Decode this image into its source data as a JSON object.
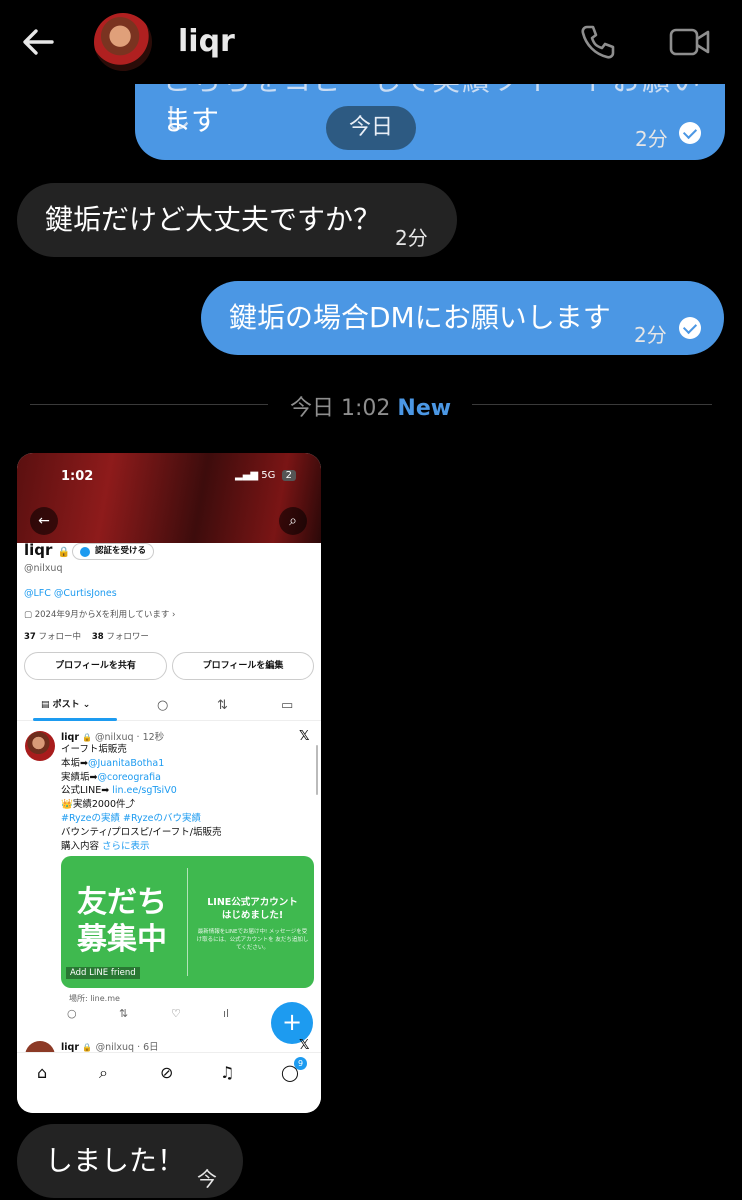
{
  "header": {
    "title": "liqr",
    "back_icon": "arrow-left-icon",
    "call_icon": "phone-icon",
    "video_icon": "video-icon"
  },
  "colors": {
    "outgoing": "#4b97e4",
    "incoming": "#232323",
    "accent_new": "#4b97e4",
    "twitter_blue": "#1d9bf0",
    "line_green": "#3fb94f"
  },
  "messages": [
    {
      "direction": "out",
      "text_cut": "こちらをコピーして実績ツイートお願いし",
      "text": "ます",
      "time": "2分"
    },
    {
      "direction": "in",
      "text": "鍵垢だけど大丈夫ですか？",
      "time": "2分"
    },
    {
      "direction": "out",
      "text": "鍵垢の場合DMにお願いします",
      "time": "2分"
    },
    {
      "direction": "in",
      "text": "しました！",
      "time": "今"
    }
  ],
  "floating_date": "今日",
  "divider": {
    "label": "今日 1:02",
    "new": "New"
  },
  "screenshot": {
    "status": {
      "time": "1:02",
      "network": "5G",
      "battery": "2"
    },
    "profile": {
      "name": "liqr",
      "verify_button": "認証を受ける",
      "handle": "@nilxuq",
      "bio": "@LFC @CurtisJones",
      "joined": "2024年9月からXを利用しています",
      "following_count": "37",
      "following_label": "フォロー中",
      "followers_count": "38",
      "followers_label": "フォロワー",
      "share_button": "プロフィールを共有",
      "edit_button": "プロフィールを編集"
    },
    "tabs": {
      "posts": "ポスト"
    },
    "tweet": {
      "name": "liqr",
      "handle_time": "@nilxuq · 12秒",
      "lines": [
        {
          "pre": "イーフト垢販売",
          "link": ""
        },
        {
          "pre": "本垢➡",
          "link": "@JuanitaBotha1"
        },
        {
          "pre": "実績垢➡",
          "link": "@coreografia"
        },
        {
          "pre": "公式LINE➡ ",
          "link": "lin.ee/sgTsiV0"
        },
        {
          "pre": "👑実績2000件⤴",
          "link": ""
        },
        {
          "pre": "",
          "link": "#Ryzeの実績 #Ryzeのバウ実績"
        },
        {
          "pre": "バウンティ/プロスピ/イーフト/垢販売",
          "link": ""
        },
        {
          "pre": "購入内容 ",
          "link": "さらに表示"
        }
      ],
      "card": {
        "big1": "友だち",
        "big2": "募集中",
        "right1": "LINE公式アカウント",
        "right2": "はじめました!",
        "small": "最新情報をLINEでお届け中! メッセージを受け取るには、公式アカウントを 友だち追加してください。",
        "add": "Add LINE friend"
      },
      "location": "場所: line.me"
    },
    "tweet2": {
      "name": "liqr",
      "handle_time": "@nilxuq · 6日"
    },
    "nav_badge": "9"
  }
}
